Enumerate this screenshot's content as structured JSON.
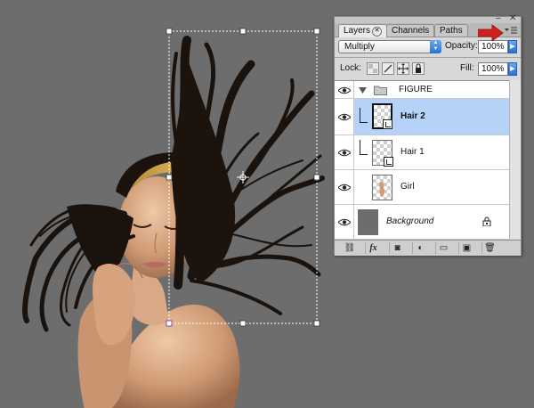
{
  "panel": {
    "tabs": [
      {
        "label": "Layers",
        "active": true
      },
      {
        "label": "Channels",
        "active": false
      },
      {
        "label": "Paths",
        "active": false
      }
    ],
    "blend_mode": "Multiply",
    "opacity_label": "Opacity:",
    "opacity_value": "100%",
    "lock_label": "Lock:",
    "fill_label": "Fill:",
    "fill_value": "100%",
    "layers": [
      {
        "name": "FIGURE",
        "type": "group",
        "visible": true,
        "expanded": true
      },
      {
        "name": "Hair 2",
        "type": "smart-object",
        "visible": true,
        "selected": true,
        "clipped": true
      },
      {
        "name": "Hair 1",
        "type": "smart-object",
        "visible": true,
        "selected": false,
        "clipped": true
      },
      {
        "name": "Girl",
        "type": "layer",
        "visible": true,
        "selected": false
      },
      {
        "name": "Background",
        "type": "background",
        "visible": true,
        "locked": true
      }
    ],
    "bottom_buttons": [
      "link-icon",
      "fx-icon",
      "mask-icon",
      "adjustment-icon",
      "folder-icon",
      "new-layer-icon",
      "trash-icon"
    ],
    "fx_label": "fx"
  },
  "colors": {
    "canvas_bg": "#6d6d6d",
    "selection_highlight": "#b5d3f8",
    "annotation_arrow": "#d21f1f",
    "mac_blue": "#2c6fd1"
  }
}
